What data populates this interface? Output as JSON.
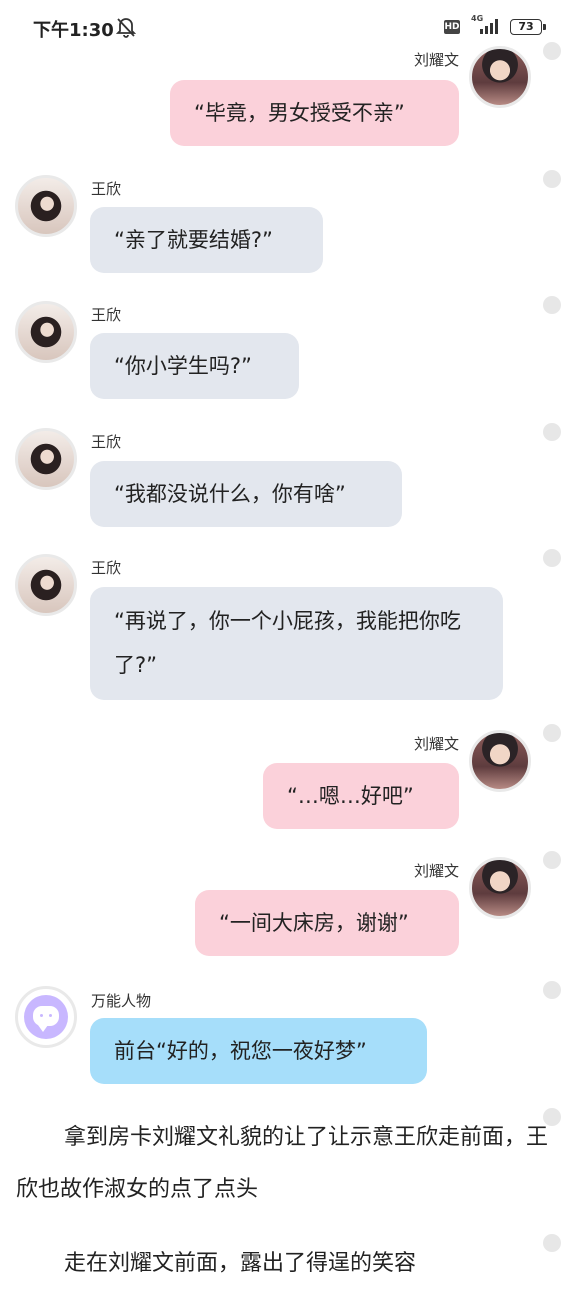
{
  "status_bar": {
    "time": "下午1:30",
    "hd": "HD",
    "network": "4G",
    "battery": "73"
  },
  "characters": {
    "liu": "刘耀文",
    "wang": "王欣",
    "wanneng": "万能人物"
  },
  "messages": [
    {
      "speaker": "刘耀文",
      "text": "“毕竟，男女授受不亲”"
    },
    {
      "speaker": "王欣",
      "text": "“亲了就要结婚?”"
    },
    {
      "speaker": "王欣",
      "text": "“你小学生吗?”"
    },
    {
      "speaker": "王欣",
      "text": "“我都没说什么，你有啥”"
    },
    {
      "speaker": "王欣",
      "text": "“再说了，你一个小屁孩，我能把你吃了?”"
    },
    {
      "speaker": "刘耀文",
      "text": "“…嗯…好吧”"
    },
    {
      "speaker": "刘耀文",
      "text": "“一间大床房，谢谢”"
    },
    {
      "speaker": "万能人物",
      "text": "前台“好的，祝您一夜好梦”"
    }
  ],
  "narration": [
    "拿到房卡刘耀文礼貌的让了让示意王欣走前面，王欣也故作淑女的点了点头",
    "走在刘耀文前面，露出了得逞的笑容"
  ],
  "icons": {
    "bell": "bell-off-icon",
    "signal": "signal-icon",
    "wanneng_avatar": "chat-bubble-icon"
  }
}
